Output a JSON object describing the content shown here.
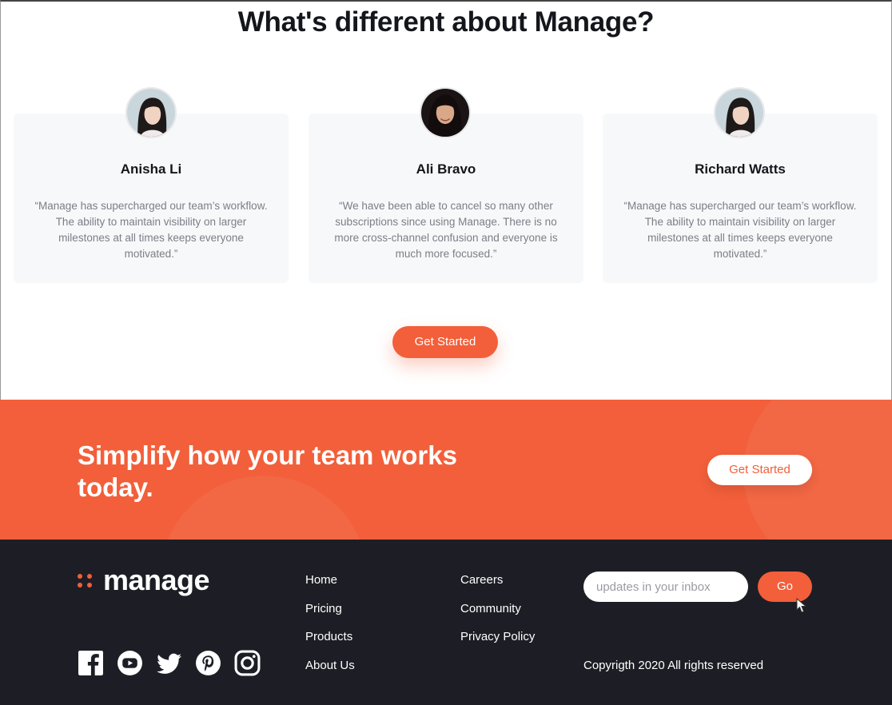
{
  "testimonials": {
    "title": "What's different about Manage?",
    "cards": [
      {
        "name": "Anisha Li",
        "quote": "“Manage has supercharged our team’s workflow. The ability to maintain visibility on larger milestones at all times keeps everyone motivated.”"
      },
      {
        "name": "Ali Bravo",
        "quote": "“We have been able to cancel so many other subscriptions since using Manage. There is no more cross-channel confusion and everyone is much more focused.”"
      },
      {
        "name": "Richard Watts",
        "quote": "“Manage has supercharged our team’s workflow. The ability to maintain visibility on larger milestones at all times keeps everyone motivated.”"
      }
    ],
    "cta_label": "Get Started"
  },
  "cta_band": {
    "heading": "Simplify how your team works today.",
    "button_label": "Get Started"
  },
  "footer": {
    "logo_text": "manage",
    "nav_col1": [
      "Home",
      "Pricing",
      "Products",
      "About Us"
    ],
    "nav_col2": [
      "Careers",
      "Community",
      "Privacy Policy"
    ],
    "newsletter_placeholder": "updates in your inbox",
    "go_label": "Go",
    "copyright": "Copyrigth 2020 All rights reserved",
    "socials": [
      "facebook-icon",
      "youtube-icon",
      "twitter-icon",
      "pinterest-icon",
      "instagram-icon"
    ]
  },
  "colors": {
    "accent": "#f25f3a",
    "dark": "#1d1e25",
    "card_bg": "#f7f8fa"
  }
}
